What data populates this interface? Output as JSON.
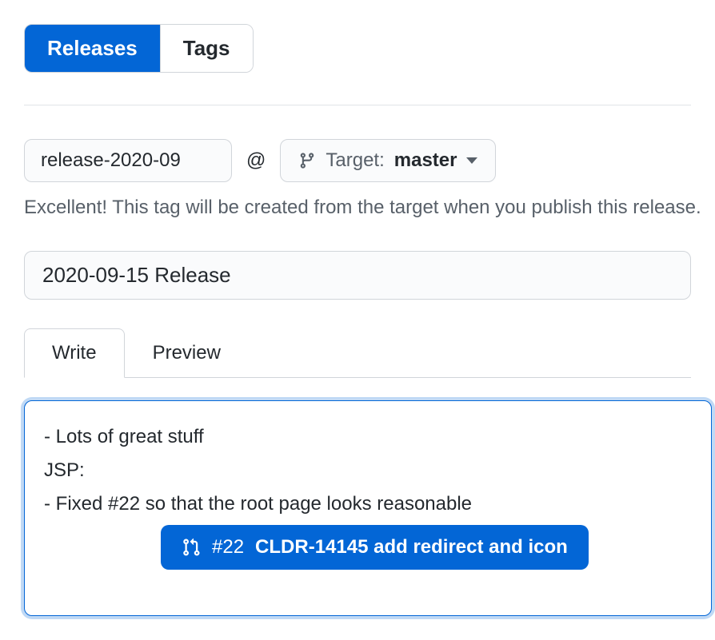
{
  "nav": {
    "releases": "Releases",
    "tags": "Tags"
  },
  "tag": {
    "value": "release-2020-09",
    "at": "@",
    "target_label": "Target:",
    "target_branch": "master"
  },
  "helper": "Excellent! This tag will be created from the target when you publish this release.",
  "title": {
    "value": "2020-09-15 Release"
  },
  "editor": {
    "tabs": {
      "write": "Write",
      "preview": "Preview"
    },
    "lines": [
      "- Lots of great stuff",
      "JSP:",
      "- Fixed #22 so that the root page looks reasonable"
    ]
  },
  "suggestion": {
    "num": "#22",
    "title": "CLDR-14145 add redirect and icon"
  }
}
